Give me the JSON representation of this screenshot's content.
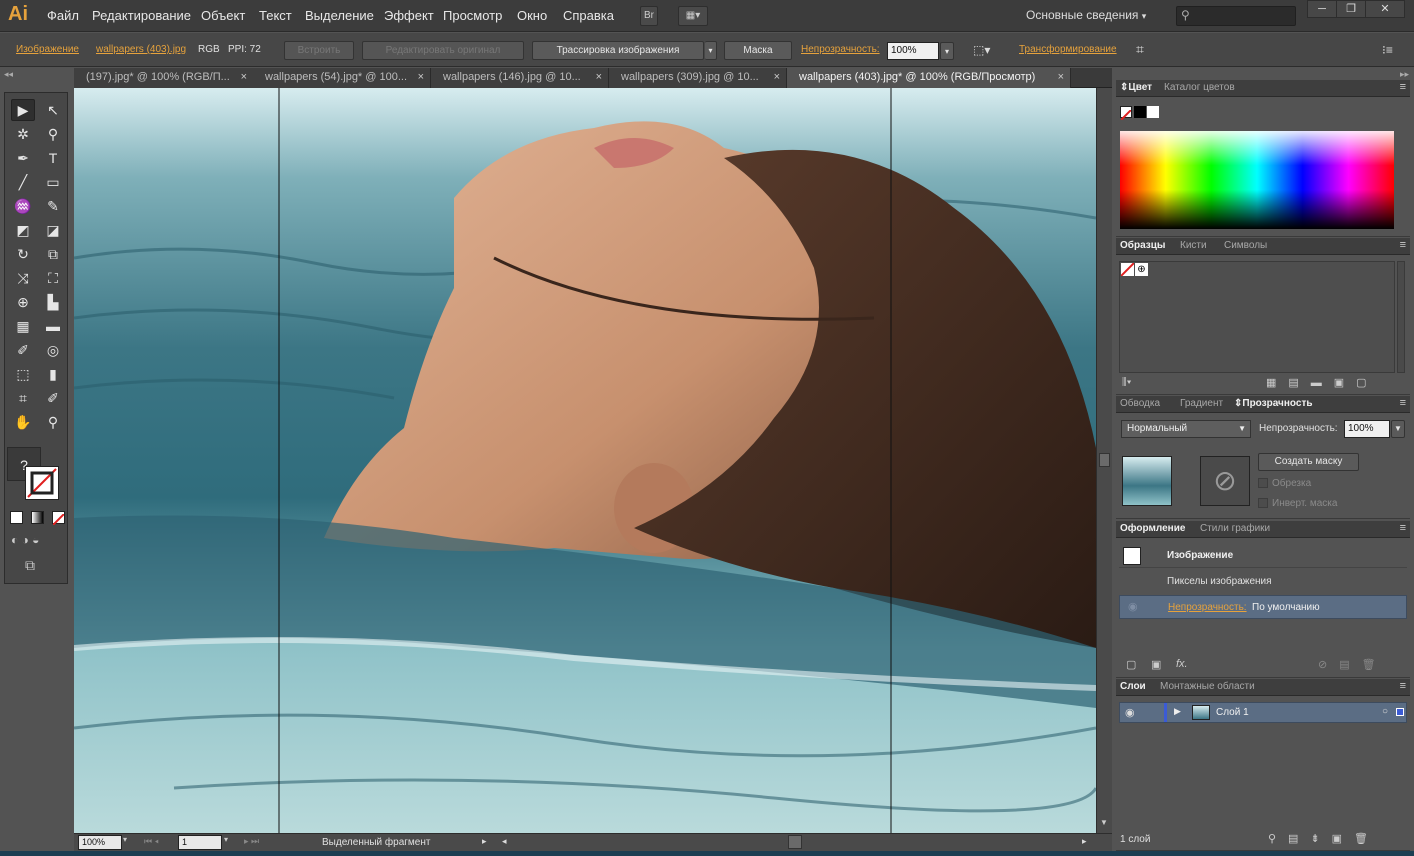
{
  "app": {
    "logo": "Ai",
    "menus": [
      "Файл",
      "Редактирование",
      "Объект",
      "Текст",
      "Выделение",
      "Эффект",
      "Просмотр",
      "Окно",
      "Справка"
    ],
    "bridge_label": "Br",
    "workspace": "Основные сведения",
    "search_placeholder": "",
    "win": [
      "─",
      "❐",
      "✕"
    ]
  },
  "control": {
    "type_link": "Изображение",
    "file_link": "wallpapers (403).jpg",
    "colormode": "RGB",
    "ppi": "PPI: 72",
    "embed": "Встроить",
    "edit_original": "Редактировать оригинал",
    "trace": "Трассировка изображения",
    "mask": "Маска",
    "opacity_label": "Непрозрачность:",
    "opacity_value": "100%",
    "transform_link": "Трансформирование"
  },
  "tabs": [
    {
      "label": "(197).jpg* @ 100% (RGB/П...",
      "close": "×"
    },
    {
      "label": "wallpapers (54).jpg* @ 100...",
      "close": "×"
    },
    {
      "label": "wallpapers (146).jpg @ 10...",
      "close": "×"
    },
    {
      "label": "wallpapers (309).jpg @ 10...",
      "close": "×"
    },
    {
      "label": "wallpapers (403).jpg* @ 100% (RGB/Просмотр)",
      "close": "×"
    }
  ],
  "toolbox": {
    "tools": [
      [
        "▶",
        "↖"
      ],
      [
        "✲",
        "⚲"
      ],
      [
        "✒",
        "T"
      ],
      [
        "╱",
        "▭"
      ],
      [
        "♒",
        "✎"
      ],
      [
        "◩",
        "◪"
      ],
      [
        "↻",
        "⧉"
      ],
      [
        "⤨",
        "⛶"
      ],
      [
        "⊕",
        "▙"
      ],
      [
        "▦",
        "▬"
      ],
      [
        "✐",
        "◎"
      ],
      [
        "⬚",
        "▮"
      ],
      [
        "⌗",
        "✐"
      ],
      [
        "✋",
        "⚲"
      ]
    ],
    "question": "?"
  },
  "status": {
    "zoom": "100%",
    "page": "1",
    "message": "Выделенный фрагмент"
  },
  "color_panel": {
    "tabs": [
      "Цвет",
      "Каталог цветов"
    ]
  },
  "swatches_panel": {
    "tabs": [
      "Образцы",
      "Кисти",
      "Символы"
    ]
  },
  "transparency_panel": {
    "tabs": [
      "Обводка",
      "Градиент",
      "Прозрачность"
    ],
    "blend": "Нормальный",
    "opacity_label": "Непрозрачность:",
    "opacity_value": "100%",
    "make_mask": "Создать маску",
    "clip": "Обрезка",
    "invert": "Инверт. маска"
  },
  "appearance_panel": {
    "tabs": [
      "Оформление",
      "Стили графики"
    ],
    "title": "Изображение",
    "row1": "Пикселы изображения",
    "opacity_link": "Непрозрачность:",
    "opacity_value": "По умолчанию",
    "fx": "fx."
  },
  "layers_panel": {
    "tabs": [
      "Слои",
      "Монтажные области"
    ],
    "layer_name": "Слой 1",
    "count": "1 слой"
  },
  "colors": {
    "accent": "#e6a23c",
    "panel": "#535353",
    "dark": "#3c3c3c",
    "selection": "#5b6d84"
  }
}
